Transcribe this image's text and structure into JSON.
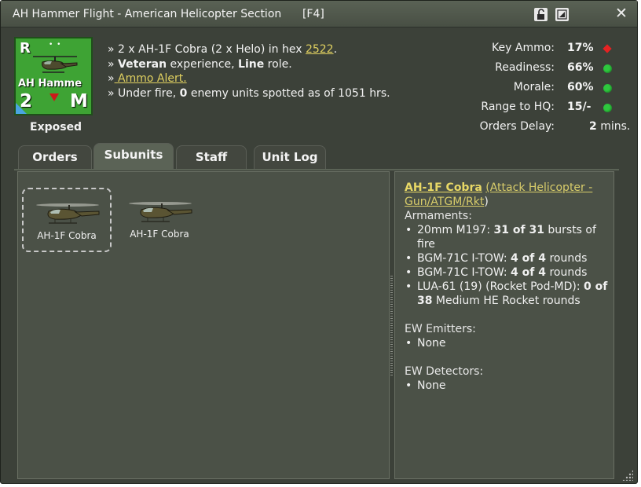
{
  "window": {
    "title": "AH Hammer Flight - American Helicopter Section",
    "hotkey": "[F4]"
  },
  "unit_icon": {
    "top_left": "R",
    "top_dots": "• •",
    "name": "AH Hamme",
    "number": "2",
    "size_letter": "M",
    "colors": {
      "background": "#3ea334",
      "marker": "#cc1a1a",
      "flag": "#4aa4e0"
    }
  },
  "status_label": "Exposed",
  "info": {
    "line1_prefix": "» 2 x AH-1F Cobra (2 x Helo) in hex ",
    "line1_hex": "2522",
    "line1_suffix": ".",
    "line2_prefix": "» ",
    "line2_experience": "Veteran",
    "line2_mid": " experience, ",
    "line2_role": "Line",
    "line2_suffix": " role.",
    "line3_prefix": "»",
    "line3_link": " Ammo Alert.",
    "line4_prefix": "» Under fire, ",
    "line4_count": "0",
    "line4_suffix": " enemy units spotted as of 1051 hrs."
  },
  "stats": [
    {
      "label": "Key Ammo:",
      "value": "17%",
      "indicator": "red-diamond"
    },
    {
      "label": "Readiness:",
      "value": "66%",
      "indicator": "green-dot"
    },
    {
      "label": "Morale:",
      "value": "60%",
      "indicator": "green-dot"
    },
    {
      "label": "Range to HQ:",
      "value": "15/-",
      "indicator": "green-dot"
    }
  ],
  "orders_delay": {
    "label": "Orders Delay:",
    "value": "2",
    "unit": " mins."
  },
  "tabs": [
    {
      "label": "Orders",
      "active": false
    },
    {
      "label": "Subunits",
      "active": true
    },
    {
      "label": "Staff",
      "active": false
    },
    {
      "label": "Unit Log",
      "active": false
    }
  ],
  "subunits": [
    {
      "label": "AH-1F Cobra",
      "selected": true
    },
    {
      "label": "AH-1F Cobra",
      "selected": false
    }
  ],
  "detail": {
    "name": "AH-1F Cobra",
    "type_link": "(Attack Helicopter - Gun/ATGM/Rkt",
    "type_close": ")",
    "armaments_header": "Armaments:",
    "armaments": [
      {
        "prefix": "20mm M197: ",
        "count": "31 of 31",
        "suffix": " bursts of fire"
      },
      {
        "prefix": "BGM-71C I-TOW: ",
        "count": "4 of 4",
        "suffix": " rounds"
      },
      {
        "prefix": "BGM-71C I-TOW: ",
        "count": "4 of 4",
        "suffix": " rounds"
      },
      {
        "prefix": "LUA-61 (19) (Rocket Pod-MD): ",
        "count": "0 of 38",
        "suffix": " Medium HE Rocket rounds"
      }
    ],
    "ew_emitters_header": "EW Emitters:",
    "ew_emitters": [
      "None"
    ],
    "ew_detectors_header": "EW Detectors:",
    "ew_detectors": [
      "None"
    ]
  },
  "icons": {
    "lock": "unlock-icon",
    "restore": "restore-icon",
    "close": "close-icon",
    "close_glyph": "✕",
    "restore_glyph": "◩",
    "resize": "resize-grip-icon"
  }
}
